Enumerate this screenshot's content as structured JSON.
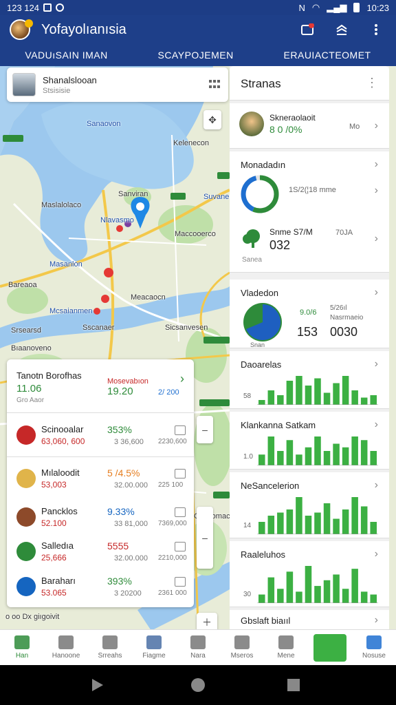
{
  "status_bar": {
    "time_left": "123 124",
    "time_right": "10:23",
    "network": "N"
  },
  "header": {
    "title": "Yofayolıanısia",
    "tabs": [
      "VADUıSAIN IMAN",
      "SCAYPOJEMEN",
      "ERAUIACTEOMET"
    ],
    "accent": "#1e3f89"
  },
  "map": {
    "labels": [
      {
        "text": "Sanaovon",
        "cls": ""
      },
      {
        "text": "Kelenecon",
        "cls": ""
      },
      {
        "text": "Sanviran",
        "cls": ""
      },
      {
        "text": "Suvanen",
        "cls": ""
      },
      {
        "text": "Maslalolaco",
        "cls": ""
      },
      {
        "text": "Nlavasmo",
        "cls": "blue"
      },
      {
        "text": "Maccooerco",
        "cls": ""
      },
      {
        "text": "Masanlon",
        "cls": "blue"
      },
      {
        "text": "Bareaoa",
        "cls": ""
      },
      {
        "text": "Meacaocn",
        "cls": ""
      },
      {
        "text": "Mcsaianmen",
        "cls": "blue"
      },
      {
        "text": "Srsearsd",
        "cls": ""
      },
      {
        "text": "Sscanaer",
        "cls": ""
      },
      {
        "text": "Sicsanvesen",
        "cls": ""
      },
      {
        "text": "Bıaanoveno",
        "cls": ""
      },
      {
        "text": "Cansomacina",
        "cls": ""
      }
    ],
    "bottom_label": "o oo  Dx giıgoivit"
  },
  "profile_card": {
    "name": "Shanalslooan",
    "subtitle": "Stsisisie"
  },
  "stats_panel": {
    "title": "Stranas",
    "user": {
      "name": "Skneraolaoit",
      "pct": "8 0 /0%",
      "tag": "Mo"
    },
    "card1": {
      "title": "Monadadın",
      "ring_caption": "1S/2(¦18 mme",
      "tree_label": "Snme S7/M",
      "tree_value": "032",
      "tree_side": "70JA",
      "tree_sub": "Sanea"
    },
    "card2": {
      "title": "Vladedon",
      "pct": "9.0/6",
      "side": "5/26ıl",
      "side2": "Nasrmaeio",
      "val1": "153",
      "val2": "0030",
      "pie_caption": "Snan"
    },
    "bar_cards": [
      {
        "title": "Daoarelas",
        "axis": "58",
        "values": [
          2,
          6,
          4,
          10,
          12,
          8,
          11,
          5,
          9,
          12,
          6,
          3,
          4
        ]
      },
      {
        "title": "Klankanna Satkam",
        "axis": "1.0",
        "values": [
          3,
          8,
          4,
          7,
          3,
          5,
          8,
          4,
          6,
          5,
          8,
          7,
          4
        ]
      },
      {
        "title": "NeSancelerion",
        "axis": "14",
        "values": [
          4,
          6,
          7,
          8,
          12,
          6,
          7,
          10,
          5,
          8,
          12,
          9,
          4
        ]
      },
      {
        "title": "Raaleluhos",
        "axis": "30",
        "values": [
          3,
          9,
          5,
          11,
          4,
          13,
          6,
          8,
          10,
          5,
          12,
          4,
          3
        ]
      }
    ],
    "footer": "Gbslaft biaııl"
  },
  "list_panel": {
    "header": {
      "title": "Tanotn Borofhas",
      "value": "11.06",
      "sub": "Gro Aaor",
      "center_label": "Mosevabıon",
      "center_value": "19.20",
      "right_value": "2/ 200"
    },
    "rows": [
      {
        "name": "Scinooalar",
        "amount": "63,060, 600",
        "pct": "353%",
        "pct_color": "#2e8b3a",
        "sub": "3 36,600",
        "val": "2230,600",
        "avatar": "#c62828"
      },
      {
        "name": "Mılaloodit",
        "amount": "53,003",
        "pct": "5 /4.5%",
        "pct_color": "#e57d1f",
        "sub": "32.00.000",
        "val": "225 100",
        "avatar": "#e0b44a"
      },
      {
        "name": "Pancklos",
        "amount": "52.100",
        "pct": "9.33%",
        "pct_color": "#1565c0",
        "sub": "33 81,000",
        "val": "7369,000",
        "avatar": "#8d4a2a"
      },
      {
        "name": "Salledıa",
        "amount": "25,666",
        "pct": "5555",
        "pct_color": "#c62828",
        "sub": "32.00.000",
        "val": "2210,000",
        "avatar": "#2e8b3a"
      },
      {
        "name": "Baraharı",
        "amount": "53.065",
        "pct": "393%",
        "pct_color": "#2e8b3a",
        "sub": "3 20200",
        "val": "2361 000",
        "avatar": "#1565c0"
      }
    ]
  },
  "bottom_nav": [
    {
      "label": "Han",
      "icon": "home-icon"
    },
    {
      "label": "Hanoone",
      "icon": "user-icon"
    },
    {
      "label": "Srreahs",
      "icon": "chat-icon"
    },
    {
      "label": "Fiagme",
      "icon": "grid-icon"
    },
    {
      "label": "Nara",
      "icon": "menu-icon"
    },
    {
      "label": "Mseros",
      "icon": "diamond-icon"
    },
    {
      "label": "Mene",
      "icon": "document-icon"
    },
    {
      "label": "",
      "icon": "note-icon"
    },
    {
      "label": "Nosuse",
      "icon": "location-icon"
    }
  ]
}
